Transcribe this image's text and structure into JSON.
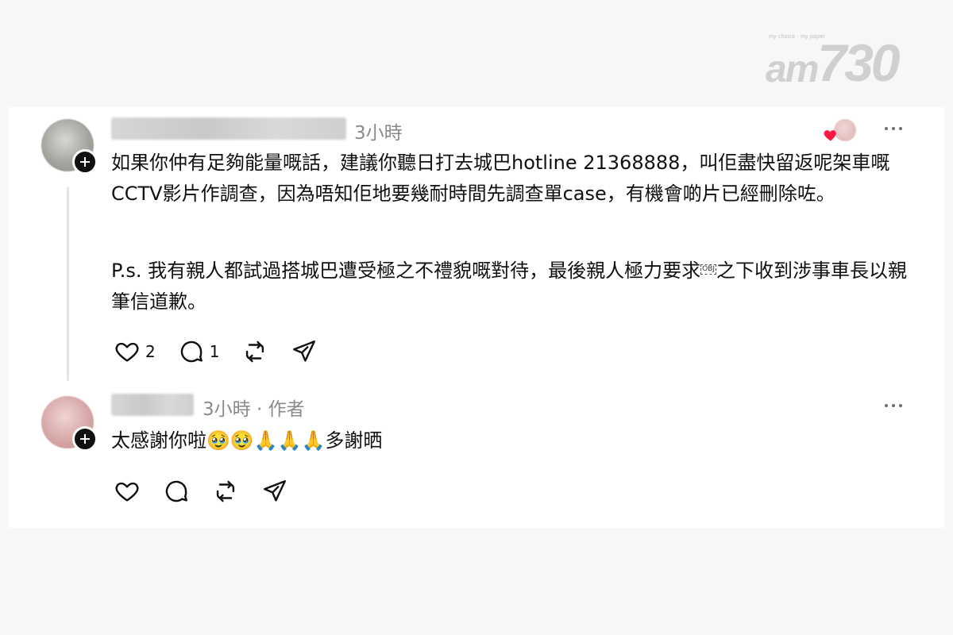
{
  "watermark": {
    "tagline": "my choice · my paper",
    "brand_prefix": "am",
    "brand_number": "730"
  },
  "comments": [
    {
      "time": "3小時",
      "author_tag": "",
      "paragraphs": [
        "如果你仲有足夠能量嘅話，建議你聽日打去城巴hotline 21368888，叫佢盡快留返呢架車嘅CCTV影片作調查，因為唔知佢地要幾耐時間先調查單case，有機會啲片已經刪除咗。",
        "P.s. 我有親人都試過搭城巴遭受極之不禮貌嘅對待，最後親人極力要求",
        "之下收到涉事車長以親筆信道歉。"
      ],
      "obj_marker": "OBJ",
      "likes": "2",
      "replies": "1",
      "liked_by_author": true
    },
    {
      "time": "3小時 · 作者",
      "paragraphs": [
        "太感謝你啦🥹🥹🙏🙏🙏多謝晒"
      ]
    }
  ],
  "icons": {
    "like": "heart-icon",
    "reply": "comment-icon",
    "repost": "repost-icon",
    "share": "send-icon",
    "more": "more-icon",
    "follow": "plus-icon"
  },
  "colors": {
    "liked_heart": "#ff1744"
  }
}
